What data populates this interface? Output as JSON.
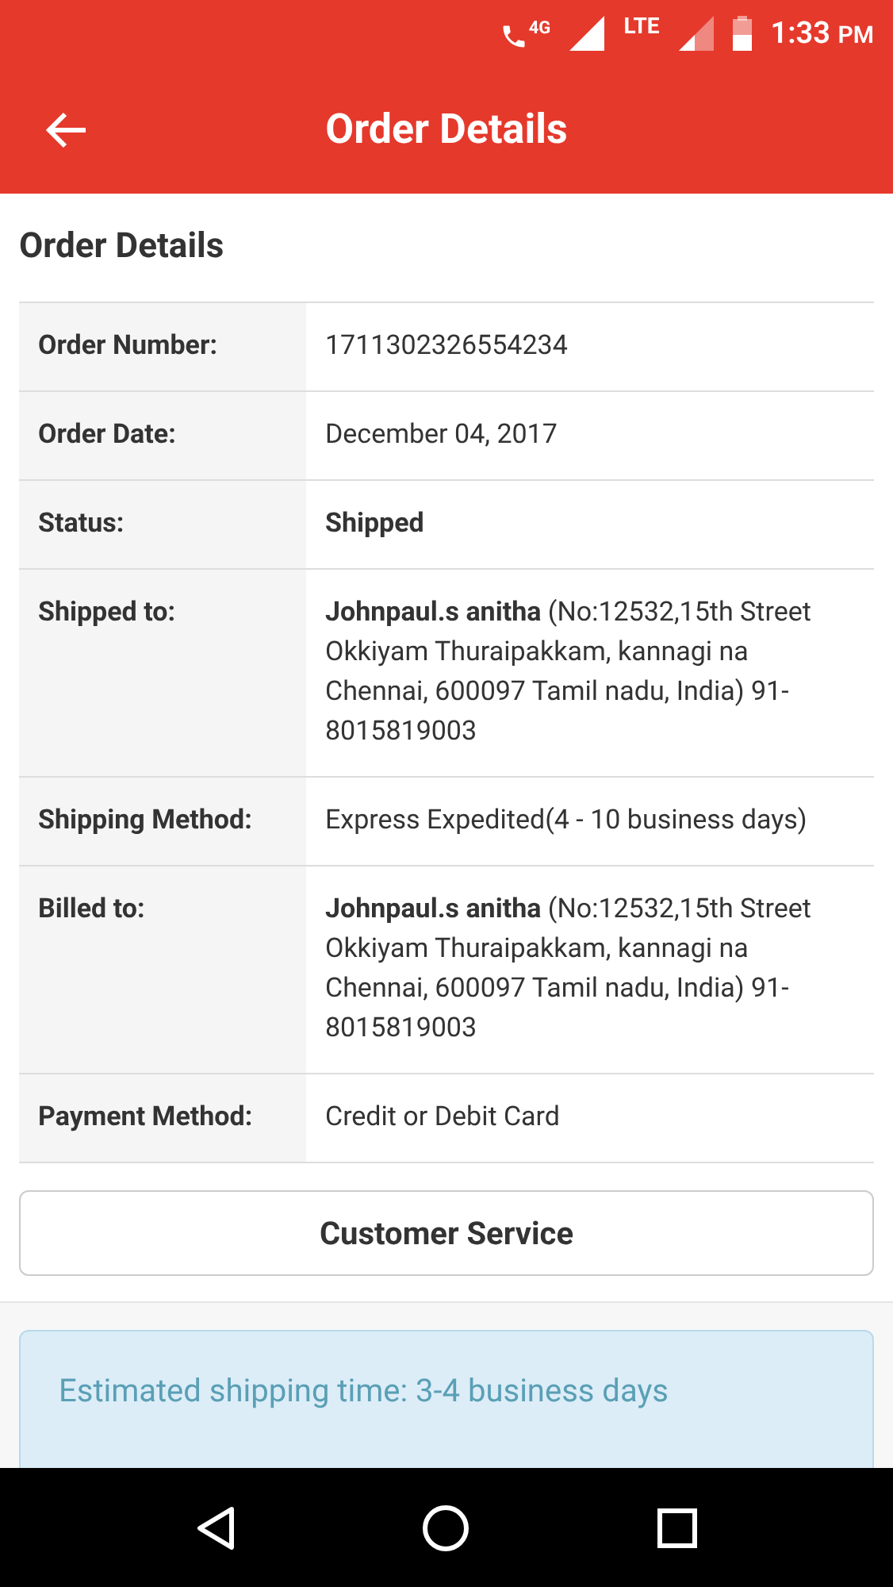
{
  "status_bar": {
    "network": "4G",
    "lte": "LTE",
    "time": "1:33",
    "ampm": "PM"
  },
  "header": {
    "title": "Order Details"
  },
  "section": {
    "title": "Order Details"
  },
  "rows": [
    {
      "label": "Order Number:",
      "value": "1711302326554234",
      "bold": false
    },
    {
      "label": "Order Date:",
      "value": "December 04, 2017",
      "bold": false
    },
    {
      "label": "Status:",
      "value": "Shipped",
      "bold": true
    },
    {
      "label": "Shipped to:",
      "value": "**Johnpaul.s anitha** (No:12532,15th Street Okkiyam Thuraipakkam, kannagi na Chennai, 600097 Tamil nadu, India) 91-8015819003",
      "bold": false
    },
    {
      "label": "Shipping Method:",
      "value": "Express Expedited(4 - 10 business days)",
      "bold": false
    },
    {
      "label": "Billed to:",
      "value": "**Johnpaul.s anitha** (No:12532,15th Street Okkiyam Thuraipakkam, kannagi na Chennai, 600097 Tamil nadu, India) 91-8015819003",
      "bold": false
    },
    {
      "label": "Payment Method:",
      "value": "Credit or Debit Card",
      "bold": false
    }
  ],
  "button": "Customer Service",
  "notice": "Estimated shipping time: 3-4 business days"
}
